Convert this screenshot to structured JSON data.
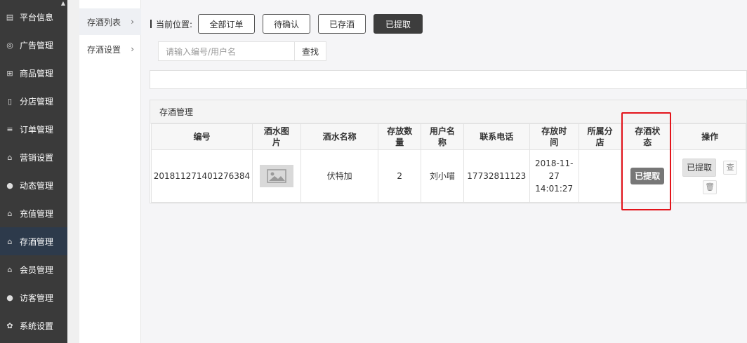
{
  "sidebar": {
    "items": [
      {
        "label": "平台信息",
        "icon": "newspaper-icon"
      },
      {
        "label": "广告管理",
        "icon": "globe-icon"
      },
      {
        "label": "商品管理",
        "icon": "cart-icon"
      },
      {
        "label": "分店管理",
        "icon": "building-icon"
      },
      {
        "label": "订单管理",
        "icon": "list-icon"
      },
      {
        "label": "营销设置",
        "icon": "gift-icon"
      },
      {
        "label": "动态管理",
        "icon": "user-icon"
      },
      {
        "label": "充值管理",
        "icon": "gift-icon"
      },
      {
        "label": "存酒管理",
        "icon": "gift-icon"
      },
      {
        "label": "会员管理",
        "icon": "gift-icon"
      },
      {
        "label": "访客管理",
        "icon": "user-icon"
      },
      {
        "label": "系统设置",
        "icon": "gear-icon"
      }
    ],
    "active_index": 8
  },
  "subnav": {
    "items": [
      {
        "label": "存酒列表",
        "chevron": "›"
      },
      {
        "label": "存酒设置",
        "chevron": "›"
      }
    ],
    "active_index": 0
  },
  "filter": {
    "label": "当前位置:",
    "buttons": [
      "全部订单",
      "待确认",
      "已存酒",
      "已提取"
    ],
    "active_index": 3
  },
  "search": {
    "placeholder": "请输入编号/用户名",
    "button": "查找"
  },
  "panel": {
    "title": "存酒管理",
    "columns": [
      "编号",
      "酒水图片",
      "酒水名称",
      "存放数量",
      "用户名称",
      "联系电话",
      "存放时间",
      "所属分店",
      "存酒状态",
      "操作"
    ],
    "rows": [
      {
        "id": "201811271401276384",
        "image": "placeholder-image",
        "name": "伏特加",
        "quantity": "2",
        "user": "刘小喵",
        "phone": "17732811123",
        "time": "2018-11-27 14:01:27",
        "branch": "",
        "status": "已提取",
        "action_label": "已提取"
      }
    ]
  },
  "colors": {
    "sidebar_bg": "#3a3a3a",
    "sidebar_active": "#2d3a4b",
    "highlight": "#e3141b",
    "status_badge": "#777777"
  }
}
